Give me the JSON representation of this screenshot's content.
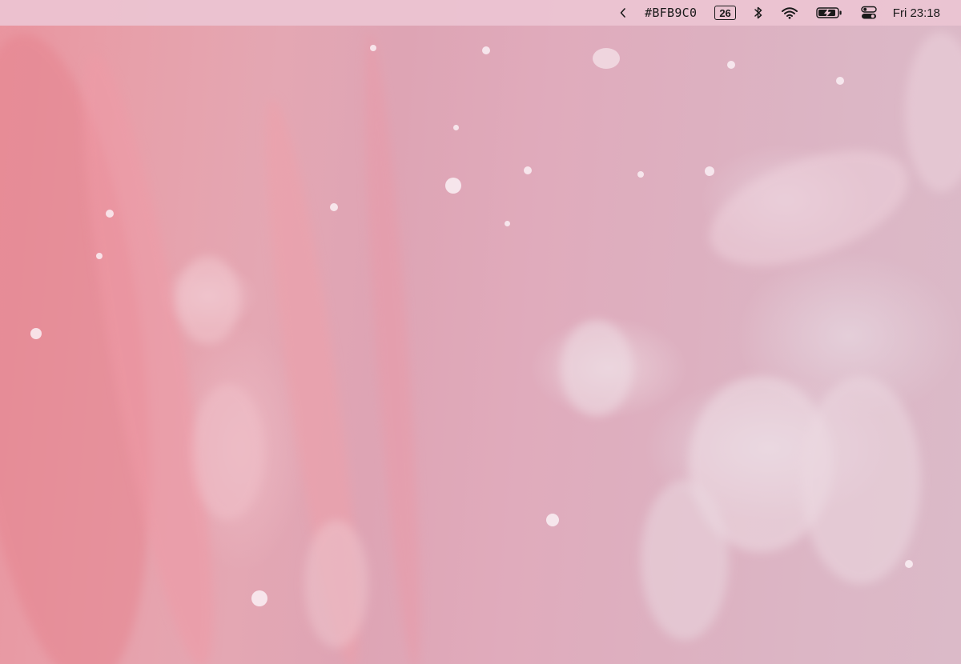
{
  "menubar": {
    "back_glyph": "‹",
    "color_hex": "#BFB9C0",
    "date_number": "26",
    "clock": "Fri 23:18",
    "icons": [
      "chevron-left-icon",
      "calendar-icon",
      "bluetooth-icon",
      "wifi-icon",
      "battery-charging-icon",
      "control-center-icon"
    ]
  },
  "desktop": {
    "wallpaper": "pink fluid marble",
    "colors": {
      "pink_dark": "#E9959F",
      "pink_mid": "#E0ABBC",
      "pink_light": "#DBBAC8",
      "menubar": "#ECC4D2"
    }
  }
}
